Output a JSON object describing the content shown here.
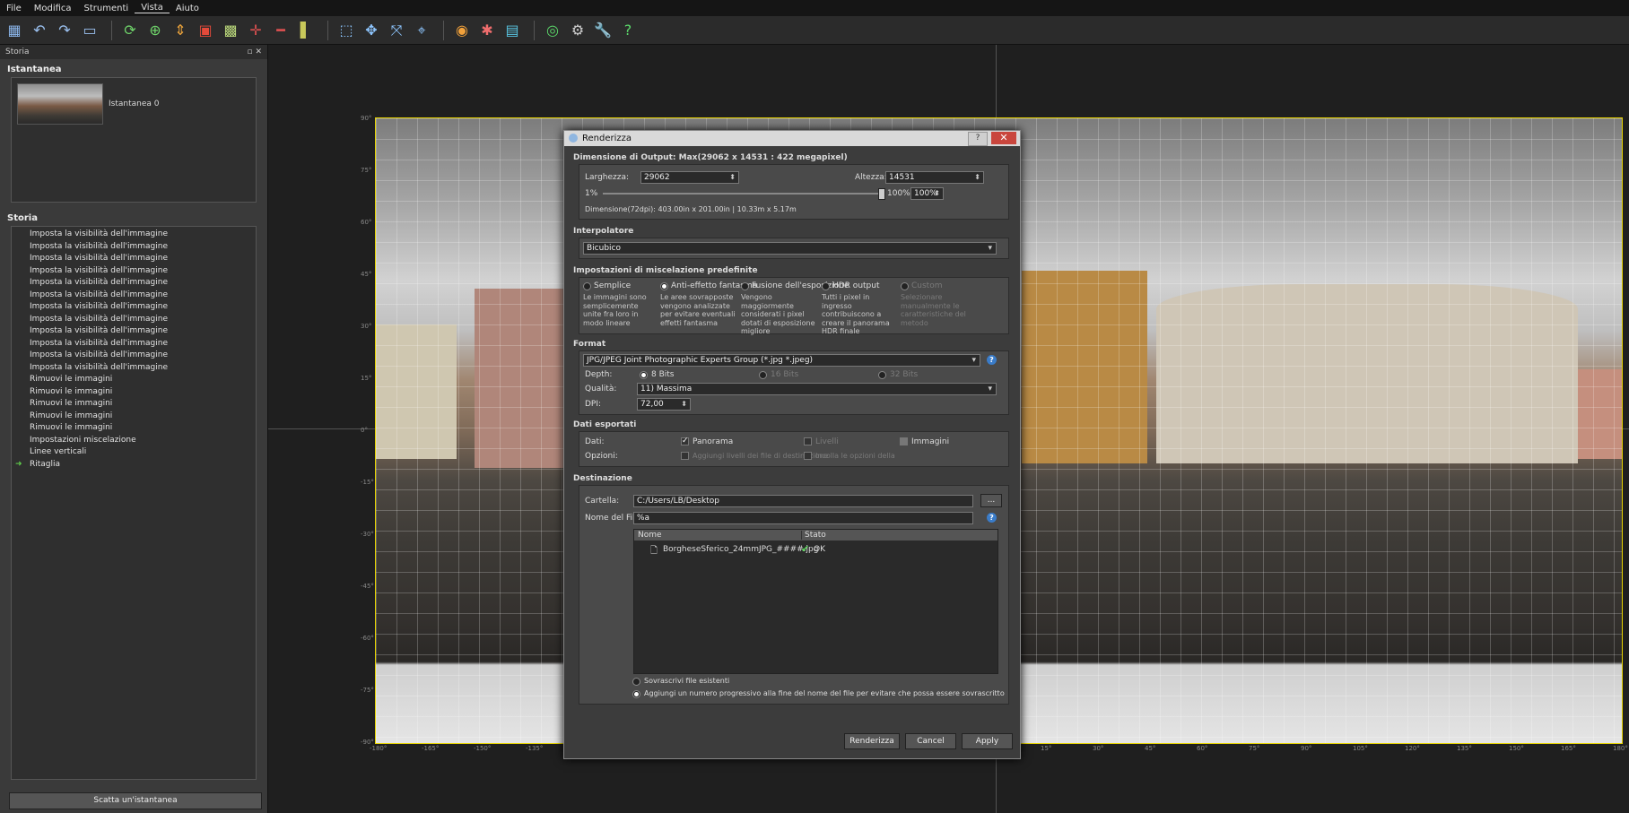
{
  "menu": [
    "File",
    "Modifica",
    "Strumenti",
    "Vista",
    "Aiuto"
  ],
  "left_panel": {
    "header": "Storia",
    "snapshot_section": "Istantanea",
    "snapshot_name": "Istantanea 0",
    "history_section": "Storia",
    "history": [
      "Imposta la visibilità dell'immagine",
      "Imposta la visibilità dell'immagine",
      "Imposta la visibilità dell'immagine",
      "Imposta la visibilità dell'immagine",
      "Imposta la visibilità dell'immagine",
      "Imposta la visibilità dell'immagine",
      "Imposta la visibilità dell'immagine",
      "Imposta la visibilità dell'immagine",
      "Imposta la visibilità dell'immagine",
      "Imposta la visibilità dell'immagine",
      "Imposta la visibilità dell'immagine",
      "Imposta la visibilità dell'immagine",
      "Rimuovi le immagini",
      "Rimuovi le immagini",
      "Rimuovi le immagini",
      "Rimuovi le immagini",
      "Rimuovi le immagini",
      "Impostazioni miscelazione",
      "Linee verticali",
      "Ritaglia"
    ],
    "snapshot_button": "Scatta un'istantanea"
  },
  "viewport": {
    "y_ticks": [
      "90°",
      "75°",
      "60°",
      "45°",
      "30°",
      "15°",
      "0°",
      "-15°",
      "-30°",
      "-45°",
      "-60°",
      "-75°",
      "-90°"
    ],
    "x_ticks_left": [
      "-180°",
      "-165°",
      "-150°",
      "-135°"
    ],
    "x_ticks_right": [
      "15°",
      "30°",
      "45°",
      "60°",
      "75°",
      "90°",
      "105°",
      "120°",
      "135°",
      "150°",
      "165°",
      "180°"
    ]
  },
  "dialog": {
    "title": "Renderizza",
    "output_section": "Dimensione di Output: Max(29062 x 14531 : 422 megapixel)",
    "width_label": "Larghezza:",
    "width_value": "29062",
    "height_label": "Altezza:",
    "height_value": "14531",
    "scale_min": "1%",
    "scale_max": "100%",
    "scale_value": "100%",
    "dimension_text": "Dimensione(72dpi): 403.00in x 201.00in | 10.33m x 5.17m",
    "interp_section": "Interpolatore",
    "interp_value": "Bicubico",
    "blend_section": "Impostazioni di miscelazione predefinite",
    "blend_options": [
      {
        "label": "Semplice",
        "desc": "Le immagini sono semplicemente unite fra loro in modo lineare"
      },
      {
        "label": "Anti-effetto fantasma",
        "desc": "Le aree sovrapposte vengono analizzate per evitare eventuali effetti fantasma"
      },
      {
        "label": "Fusione dell'esposizione",
        "desc": "Vengono maggiormente considerati i pixel dotati di esposizione migliore"
      },
      {
        "label": "HDR output",
        "desc": "Tutti i pixel in ingresso contribuiscono a creare il panorama HDR finale"
      },
      {
        "label": "Custom",
        "desc": "Selezionare manualmente le caratteristiche del metodo"
      }
    ],
    "format_section": "Format",
    "format_value": "JPG/JPEG Joint Photographic Experts Group (*.jpg *.jpeg)",
    "depth_label": "Depth:",
    "depth_options": [
      "8 Bits",
      "16 Bits",
      "32 Bits"
    ],
    "quality_label": "Qualità:",
    "quality_value": "11) Massima",
    "dpi_label": "DPI:",
    "dpi_value": "72,00",
    "export_section": "Dati esportati",
    "data_label": "Dati:",
    "data_options": [
      "Panorama",
      "Livelli",
      "Immagini"
    ],
    "options_label": "Opzioni:",
    "options": [
      "Aggiungi livelli dei file di destinazione",
      "Incolla le opzioni della"
    ],
    "dest_section": "Destinazione",
    "folder_label": "Cartella:",
    "folder_value": "C:/Users/LB/Desktop",
    "filename_label": "Nome del File:",
    "filename_value": "%a",
    "browse_label": "...",
    "file_header_name": "Nome",
    "file_header_state": "Stato",
    "file_name": "BorgheseSferico_24mmJPG_####.jpg",
    "file_state": "OK",
    "overwrite_label": "Sovrascrivi file esistenti",
    "progressive_label": "Aggiungi un numero progressivo alla fine del nome del file per evitare che possa essere sovrascritto",
    "render_button": "Renderizza",
    "cancel_button": "Cancel",
    "apply_button": "Apply",
    "help_mark": "?"
  }
}
